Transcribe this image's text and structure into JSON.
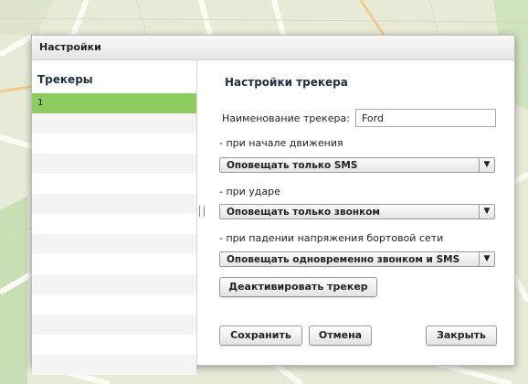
{
  "dialog": {
    "title": "Настройки"
  },
  "trackers": {
    "header": "Трекеры",
    "items": [
      "1",
      "",
      "",
      "",
      "",
      "",
      "",
      "",
      "",
      "",
      "",
      "",
      "",
      ""
    ]
  },
  "settings": {
    "title": "Настройки трекера",
    "name_label": "Наименование трекера:",
    "name_value": "Ford",
    "movement_label": "- при начале движения",
    "movement_option": "Оповещать только SMS",
    "impact_label": "- при ударе",
    "impact_option": "Оповещать только звонком",
    "voltage_label": "- при падении напряжения бортовой сети",
    "voltage_option": "Оповещать одновременно звонком и SMS",
    "dropdown_arrow": "▼"
  },
  "buttons": {
    "deactivate": "Деактивировать трекер",
    "save": "Сохранить",
    "cancel": "Отмена",
    "close": "Закрыть"
  },
  "colors": {
    "selected_row": "#8fcc5f",
    "map_background": "#e8ead8",
    "map_road": "#fbfbf4",
    "map_green": "#c8dfb4"
  }
}
